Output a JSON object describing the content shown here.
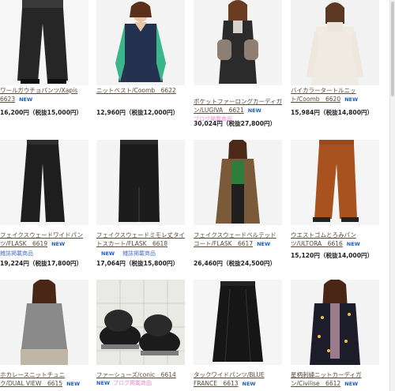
{
  "products": [
    {
      "name1": "ワールガウチョパンツ/Xapis",
      "name2": "6623",
      "new": "NEW",
      "blog": "",
      "price": "16,200円（税抜15,000円）"
    },
    {
      "name1": "ニットベスト/Coomb　6622",
      "name2": "",
      "new": "",
      "blog": "",
      "price": "12,960円（税抜12,000円）"
    },
    {
      "name1": "ポケットファーロングカーディガ",
      "name2": "ン/LUGIVA　6621",
      "new": "NEW",
      "blog": "ブログ掲載商品",
      "price": "30,024円（税抜27,800円）"
    },
    {
      "name1": "バイカラータートルニッ",
      "name2": "ト/Coomb　6620",
      "new": "NEW",
      "blog": "",
      "price": "15,984円（税抜14,800円）"
    },
    {
      "name1": "フェイクスウェードワイドパン",
      "name2": "ツ/FLASK　6619",
      "new": "NEW",
      "blog": "雑誌掲載商品",
      "price": "19,224円（税抜17,800円）"
    },
    {
      "name1": "フェイクスウェードミモレ丈タイ",
      "name2": "トスカート/FLASK　6618",
      "new": "NEW",
      "blog": "雑誌掲載商品",
      "price": "17,064円（税抜15,800円）"
    },
    {
      "name1": "フェイクスウェードベルテッド",
      "name2": "コート/FLASK　6617",
      "new": "NEW",
      "blog": "",
      "price": "26,460円（税抜24,500円）"
    },
    {
      "name1": "ウエストゴムとろみパン",
      "name2": "ツ/ULTORA　6616",
      "new": "NEW",
      "blog": "",
      "price": "15,120円（税抜14,000円）"
    },
    {
      "name1": "ホカレースニットチュニ",
      "name2": "ク/DUAL VIEW　6615",
      "new": "NEW",
      "blog": "",
      "price": ""
    },
    {
      "name1": "ファーシューズ/conic　6614",
      "name2": "",
      "new": "",
      "blog": "ブログ掲載商品",
      "price": ""
    },
    {
      "name1": "タックワイドパンツ/BLUE",
      "name2": "FRANCE　6613",
      "new": "NEW",
      "blog": "",
      "price": ""
    },
    {
      "name1": "星柄刺繍ニットカーディガ",
      "name2": "ン/Civilise　6612",
      "new": "NEW",
      "blog": "",
      "price": ""
    }
  ],
  "colors": {
    "new": "#1a5fc4",
    "blog": "#e58ad2",
    "link": "#5a4a3a"
  }
}
